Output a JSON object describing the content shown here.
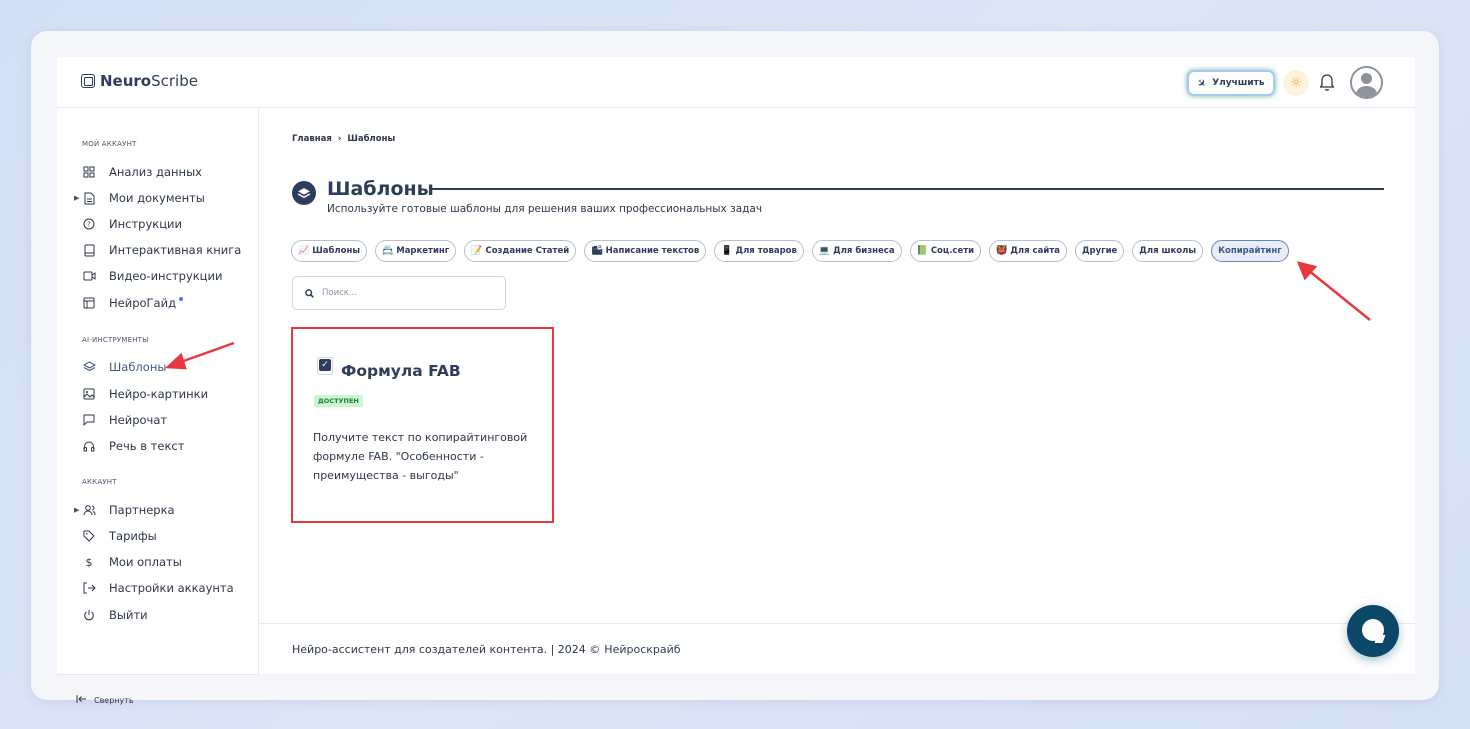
{
  "app": {
    "logo_bold": "Neuro",
    "logo_regular": "Scribe"
  },
  "header": {
    "upgrade_label": "Улучшить"
  },
  "sidebar": {
    "sections": [
      {
        "title": "МОЙ АККАУНТ"
      },
      {
        "title": "AI-ИНСТРУМЕНТЫ"
      },
      {
        "title": "АККАУНТ"
      }
    ],
    "items": [
      {
        "label": "Анализ данных",
        "icon": "grid-icon"
      },
      {
        "label": "Мои документы",
        "icon": "document-icon"
      },
      {
        "label": "Инструкции",
        "icon": "help-circle-icon"
      },
      {
        "label": "Интерактивная книга",
        "icon": "book-icon"
      },
      {
        "label": "Видео-инструкции",
        "icon": "video-icon"
      },
      {
        "label": "НейроГайд",
        "icon": "layout-icon"
      },
      {
        "label": "Шаблоны",
        "icon": "layers-icon"
      },
      {
        "label": "Нейро-картинки",
        "icon": "image-icon"
      },
      {
        "label": "Нейрочат",
        "icon": "message-square-icon"
      },
      {
        "label": "Речь в текст",
        "icon": "headphones-icon"
      },
      {
        "label": "Партнерка",
        "icon": "users-icon"
      },
      {
        "label": "Тарифы",
        "icon": "tag-icon"
      },
      {
        "label": "Мои оплаты",
        "icon": "dollar-icon"
      },
      {
        "label": "Настройки аккаунта",
        "icon": "log-in-icon"
      },
      {
        "label": "Выйти",
        "icon": "power-icon"
      }
    ],
    "collapse_label": "Свернуть"
  },
  "main": {
    "breadcrumb": [
      "Главная",
      "Шаблоны"
    ],
    "title": "Шаблоны",
    "subtitle": "Используйте готовые шаблоны для решения ваших профессиональных задач",
    "chips": [
      {
        "emoji": "📈",
        "label": "Шаблоны"
      },
      {
        "emoji": "📇",
        "label": "Маркетинг"
      },
      {
        "emoji": "📝",
        "label": "Создание Статей"
      },
      {
        "emoji": "🏙",
        "label": "Написание текстов"
      },
      {
        "emoji": "📱",
        "label": "Для товаров"
      },
      {
        "emoji": "💻",
        "label": "Для бизнеса"
      },
      {
        "emoji": "📗",
        "label": "Соц.сети"
      },
      {
        "emoji": "👹",
        "label": "Для сайта"
      },
      {
        "emoji": "",
        "label": "Другие"
      },
      {
        "emoji": "",
        "label": "Для школы"
      },
      {
        "emoji": "",
        "label": "Копирайтинг"
      }
    ],
    "active_chip": "Копирайтинг",
    "search": {
      "placeholder": "Поиск...",
      "value": ""
    },
    "card": {
      "title": "Формула FAB",
      "badge": "доступен",
      "description": "Получите текст по копирайтинговой формуле FAB. \"Особенности - преимущества - выгоды\""
    }
  },
  "footer": {
    "text": "Нейро-ассистент для создателей контента.  | 2024 ©",
    "link": "Нейроскрайб"
  },
  "colors": {
    "brand": "#2c3e5c",
    "highlight_red": "#e8383f",
    "badge_green_bg": "#c9f7d2",
    "chat_button": "#0b4868"
  }
}
